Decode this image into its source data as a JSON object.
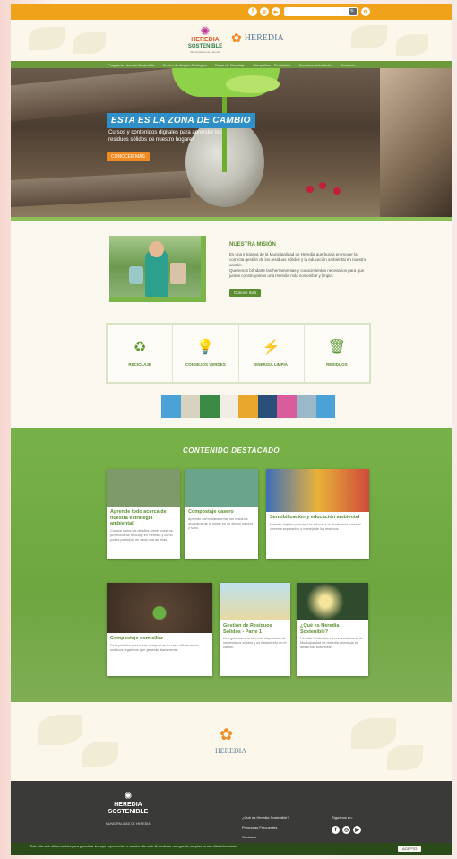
{
  "topbar": {
    "social": [
      "f",
      "◎",
      "▶"
    ],
    "search_placeholder": "",
    "search_go": "🔍",
    "gear": "⚙"
  },
  "logos": {
    "primary": {
      "line1": "HEREDIA",
      "line2": "SOSTENIBLE",
      "line3": "Municipalidad de Heredia"
    },
    "secondary": "HEREDIA"
  },
  "nav": {
    "items": [
      "Programa Heredia Sostenible",
      "Centro de Acopio Ecológico",
      "Rutas de Reciclaje",
      "Campañas y Reciclatón",
      "Nuestras Actividades",
      "Contacto"
    ]
  },
  "hero": {
    "title": "ESTA ES LA ZONA DE CAMBIO",
    "subtitle": "Cursos y contenidos digitales para aprender los residuos sólidos de nuestro hogares",
    "button": "CONOCER MÁS"
  },
  "mission": {
    "heading": "NUESTRA MISIÓN",
    "text1": "Es una iniciativa de la Municipalidad de Heredia que busca promover la correcta gestión de los residuos sólidos y la educación ambiental en nuestro cantón.",
    "text2": "Queremos brindarte las herramientas y conocimientos necesarios para que juntos construyamos una Heredia más sostenible y limpia.",
    "button": "Conoce más"
  },
  "features": [
    {
      "icon": "recycle-icon",
      "glyph": "♻",
      "label": "RECICLAJE"
    },
    {
      "icon": "lightbulb-icon",
      "glyph": "💡",
      "label": "CONSEJOS VERDES"
    },
    {
      "icon": "energy-icon",
      "glyph": "⚡",
      "label": "ENERGÍA LIMPIA"
    },
    {
      "icon": "bin-icon",
      "glyph": "🗑",
      "label": "RESIDUOS"
    }
  ],
  "featured": {
    "heading": "CONTENIDO DESTACADO",
    "cards": [
      {
        "title": "Aprende todo acerca de nuestra estrategia ambiental",
        "text": "Conoce todos los detalles sobre nuestros proyectos de reciclaje en Heredia y cómo podés participar en cada una de ellas.",
        "img": "#7e9a6a"
      },
      {
        "title": "Compostaje casero",
        "text": "Aprende cómo transformar los residuos orgánicos de tu hogar en un abono natural y sano.",
        "img": "#6aa48a"
      },
      {
        "title": "Sensibilización y educación ambiental",
        "text": "Nuestro objetivo principal es educar a la ciudadanía sobre la correcta separación y manejo de los residuos.",
        "img": "#3f6fb8"
      },
      {
        "title": "Compostaje domiciliar",
        "text": "Guía práctica para hacer compost en tu casa utilizando los residuos orgánicos que generas diariamente.",
        "img": "#5a4534"
      },
      {
        "title": "Gestión de Residuos Sólidos - Parte 1",
        "text": "Una guía sobre la correcta disposición de los residuos sólidos y su tratamiento en el cantón.",
        "img": "#9cc7d9"
      },
      {
        "title": "¿Qué es Heredia Sostenible?",
        "text": "Heredia Sostenible es una iniciativa de la Municipalidad de Heredia orientada al desarrollo sostenible.",
        "img": "#2f4a2c"
      }
    ]
  },
  "footer": {
    "brand1": "HEREDIA",
    "brand2": "SOSTENIBLE",
    "tag": "MUNICIPALIDAD DE HEREDIA",
    "links": [
      "¿Qué es Heredia Sostenible?",
      "Preguntas Frecuentes",
      "Contacto"
    ],
    "follow": "Síguenos en:"
  },
  "cookie": {
    "message": "Este sitio web utiliza cookies para garantizar la mejor experiencia en nuestro sitio web. Al continuar navegando, aceptas su uso. Más información",
    "button": "ACEPTO"
  }
}
